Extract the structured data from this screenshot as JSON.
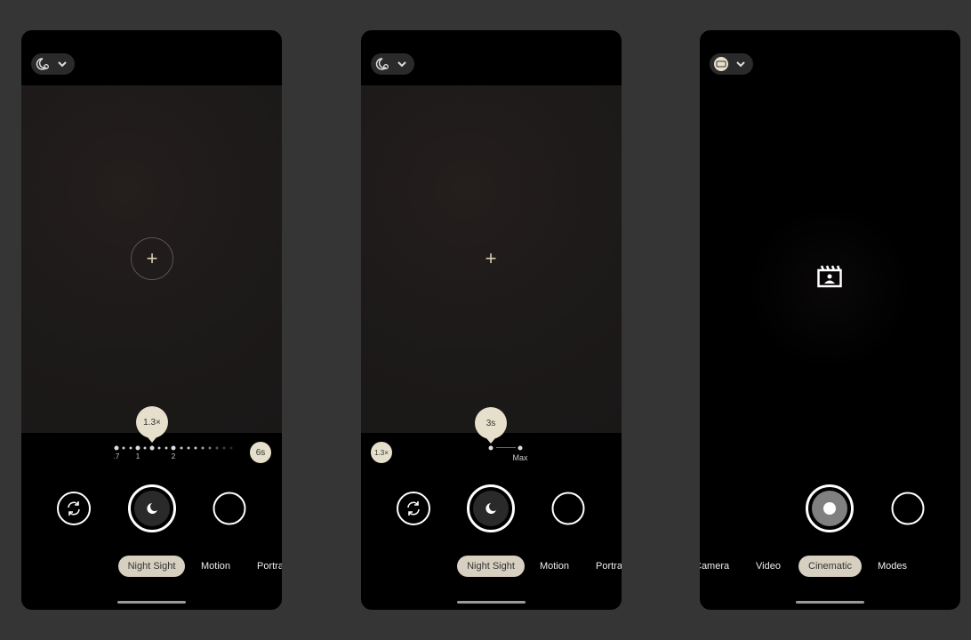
{
  "colors": {
    "accent": "#e6dfcb",
    "active_mode_bg": "#d7d0c1",
    "background": "#353535"
  },
  "screens": [
    {
      "settings_icon": "night-mode-settings-icon",
      "zoom_bubble": "1.3×",
      "zoom_ticks": [
        ".7",
        "1",
        "2"
      ],
      "exposure_button": "6s",
      "modes": [
        "Night Sight",
        "Motion",
        "Portra"
      ],
      "active_mode": "Night Sight"
    },
    {
      "settings_icon": "night-mode-settings-icon",
      "exposure_bubble": "3s",
      "slider_max_label": "Max",
      "zoom_button": "1.3×",
      "modes": [
        "Night Sight",
        "Motion",
        "Portra"
      ],
      "active_mode": "Night Sight"
    },
    {
      "settings_icon": "fhd-icon",
      "center_icon": "cinematic-clapper-icon",
      "modes": [
        "Camera",
        "Video",
        "Cinematic",
        "Modes"
      ],
      "active_mode": "Cinematic"
    }
  ]
}
